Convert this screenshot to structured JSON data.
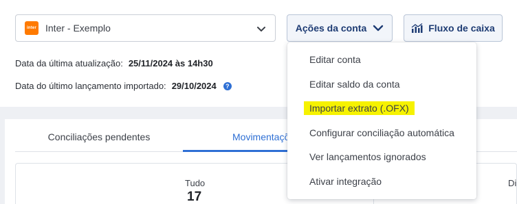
{
  "account_select": {
    "bank_logo_text": "inter",
    "account_name": "Inter - Exemplo",
    "chevron_icon": "chevron-down-icon"
  },
  "buttons": {
    "account_actions": "Ações da conta",
    "cash_flow": "Fluxo de caixa",
    "cash_flow_icon": "bar-chart-icon"
  },
  "info": {
    "last_update_label": "Data da última atualização:",
    "last_update_value": "25/11/2024 às 14h30",
    "last_import_label": "Data do último lançamento importado:",
    "last_import_value": "29/10/2024",
    "help_icon": "question-icon",
    "help_glyph": "?"
  },
  "tabs": [
    {
      "label": "Conciliações pendentes"
    },
    {
      "label": "Movimentações"
    }
  ],
  "stats": {
    "all_label": "Tudo",
    "all_value": "17",
    "right_label_partial": "Di"
  },
  "dropdown": {
    "items": [
      {
        "label": "Editar conta"
      },
      {
        "label": "Editar saldo da conta"
      },
      {
        "label": "Importar extrato (.OFX)",
        "highlighted": true
      },
      {
        "label": "Configurar conciliação automática"
      },
      {
        "label": "Ver lançamentos ignorados"
      },
      {
        "label": "Ativar integração"
      }
    ]
  },
  "colors": {
    "accent_blue": "#2e6fd4",
    "button_text": "#1d3b73",
    "bank_orange": "#ff7a00",
    "highlight_yellow": "#f6f200",
    "background": "#eef0f4"
  }
}
